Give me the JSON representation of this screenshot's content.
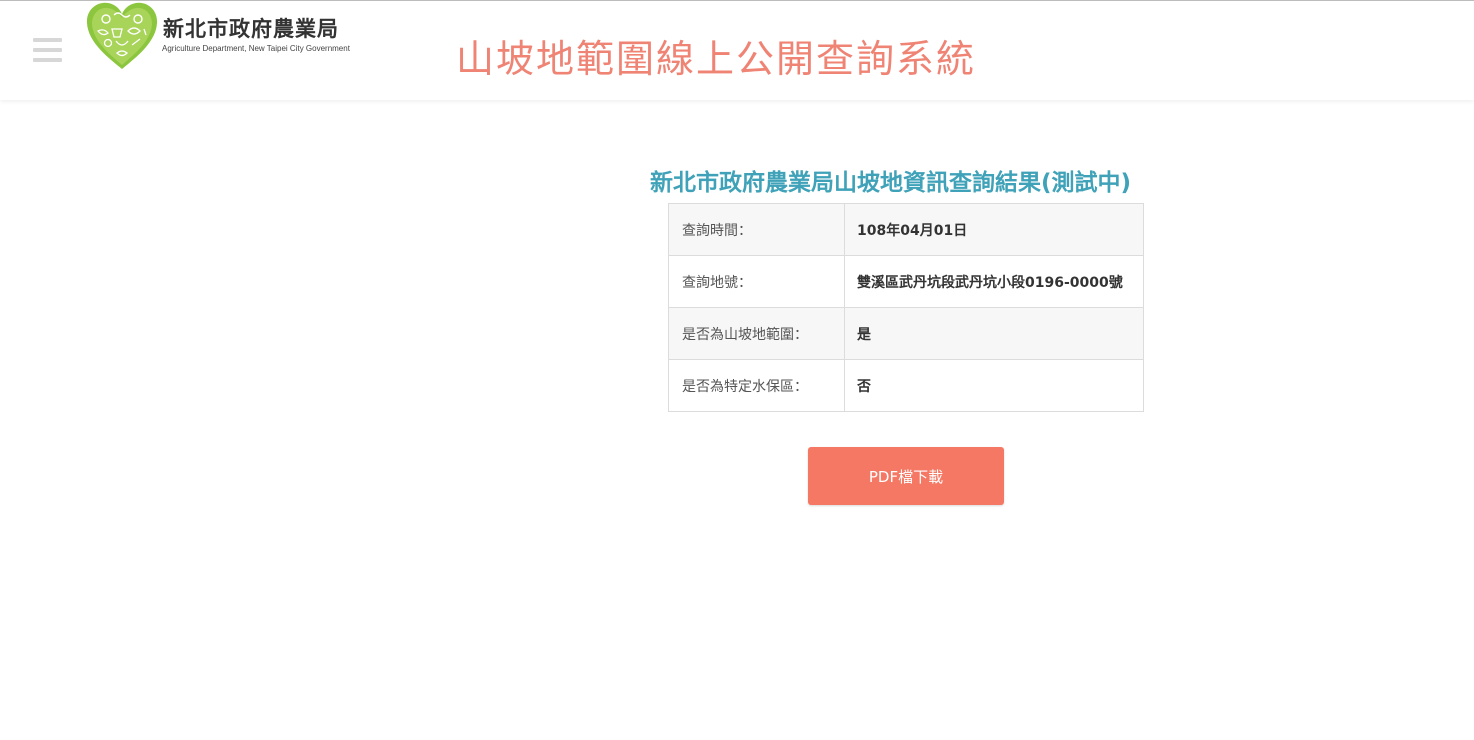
{
  "header": {
    "logo_cn": "新北市政府農業局",
    "logo_en": "Agriculture Department, New Taipei City Government",
    "site_title": "山坡地範圍線上公開查詢系統"
  },
  "main": {
    "heading": "新北市政府農業局山坡地資訊查詢結果(測試中)",
    "rows": [
      {
        "label": "查詢時間：",
        "value": "108年04月01日"
      },
      {
        "label": "查詢地號：",
        "value": "雙溪區武丹坑段武丹坑小段0196-0000號"
      },
      {
        "label": "是否為山坡地範圍：",
        "value": "是"
      },
      {
        "label": "是否為特定水保區：",
        "value": "否"
      }
    ],
    "pdf_button_label": "PDF檔下載"
  },
  "colors": {
    "title": "#ef8374",
    "heading": "#3fa2b8",
    "button": "#f47864",
    "logo_green": "#8cc63f"
  }
}
